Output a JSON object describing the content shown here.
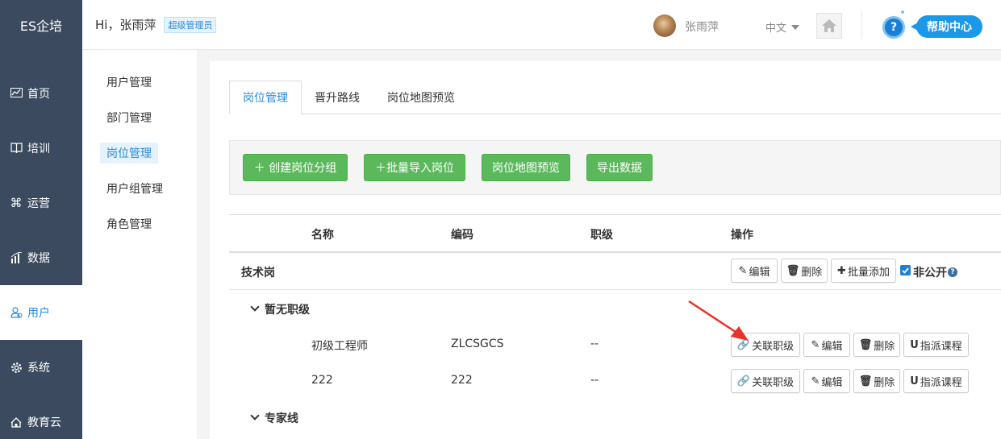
{
  "app": {
    "logo": "ES企培"
  },
  "header": {
    "greeting": "Hi，张雨萍",
    "role_badge": "超级管理员",
    "user_name": "张雨萍",
    "language": "中文",
    "help_label": "帮助中心"
  },
  "leftnav": {
    "items": [
      {
        "label": "首页",
        "icon": "chart-icon"
      },
      {
        "label": "培训",
        "icon": "book-icon"
      },
      {
        "label": "运营",
        "icon": "command-icon"
      },
      {
        "label": "数据",
        "icon": "bar-chart-icon"
      },
      {
        "label": "用户",
        "icon": "users-icon"
      },
      {
        "label": "系统",
        "icon": "gear-icon"
      },
      {
        "label": "教育云",
        "icon": "cloud-icon"
      }
    ],
    "active": "用户"
  },
  "subnav": {
    "items": [
      "用户管理",
      "部门管理",
      "岗位管理",
      "用户组管理",
      "角色管理"
    ],
    "active": "岗位管理"
  },
  "tabs": [
    "岗位管理",
    "晋升路线",
    "岗位地图预览"
  ],
  "toolbar": {
    "create_group": "＋ 创建岗位分组",
    "batch_import": "＋批量导入岗位",
    "map_preview": "岗位地图预览",
    "export": "导出数据"
  },
  "table": {
    "headers": {
      "name": "名称",
      "code": "编码",
      "level": "职级",
      "actions": "操作"
    },
    "group": {
      "name": "技术岗",
      "edit": "编辑",
      "delete": "删除",
      "batch_add": "批量添加",
      "private_label": "非公开",
      "private_checked": true
    },
    "subgroups": [
      {
        "label": "暂无职级"
      },
      {
        "label": "专家线"
      }
    ],
    "rows": [
      {
        "name": "初级工程师",
        "code": "ZLCSGCS",
        "level": "--"
      },
      {
        "name": "222",
        "code": "222",
        "level": "--"
      }
    ],
    "row_actions": {
      "link_level": "关联职级",
      "edit": "编辑",
      "delete": "删除",
      "assign_course": "指派课程"
    }
  },
  "colors": {
    "sidebar": "#3b4a5e",
    "accent": "#2a8ad8",
    "success": "#5cb85c",
    "arrow": "#e8322b"
  }
}
